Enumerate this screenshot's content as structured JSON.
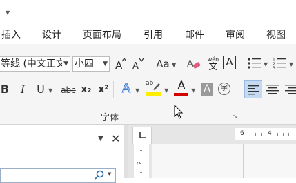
{
  "tabs": [
    "插入",
    "设计",
    "页面布局",
    "引用",
    "邮件",
    "审阅",
    "视图"
  ],
  "font": {
    "name_value": "等线 (中文正文",
    "size_value": "小四",
    "group_label": "字体",
    "aa_label": "Aa",
    "wen_top": "wén",
    "wen_bottom": "文",
    "char_border_label": "A",
    "bold": "B",
    "italic": "I",
    "underline": "U",
    "strike": "abc",
    "subscript": "x₂",
    "superscript": "x²",
    "text_effect": "A",
    "highlight_label": "ab",
    "font_color_label": "A",
    "shading_label": "A",
    "enclose_label": "字",
    "highlight_color": "#ffee00",
    "font_color": "#d40000"
  },
  "ruler": {
    "h_marks": [
      "6",
      "4"
    ],
    "v_marks": [
      "2"
    ]
  },
  "colors": {
    "ribbon_bg": "#f5f5f5",
    "active_align_bg": "#c5d9f1"
  }
}
